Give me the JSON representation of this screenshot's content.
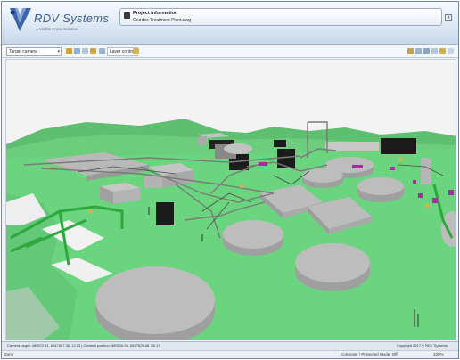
{
  "header": {
    "logo_brand": "RDV Systems",
    "logo_tagline": "A Visible Force Solution",
    "info_title": "Project information",
    "info_file": "Goodoo Treatment Plant.dwg",
    "close_label": "x"
  },
  "toolbar": {
    "camera_value": "Target camera",
    "layer_control_label": "Layer control"
  },
  "status": {
    "camera_readout": "Camera target: 489572.61, 6547657.36, 12.03 | Camera position: 489526.38, 6547625.68, 55.17",
    "copyright": "Copyright 2017 © RDV Systems"
  },
  "browser_status": {
    "zone": "Zone",
    "protected_mode": "Computer | Protected Mode: Off",
    "zoom": "100%"
  },
  "colors": {
    "terrain": "#6ad47e",
    "hills": "#52b565",
    "structure": "#b9b9b9",
    "building_dark": "#1b1b1b",
    "accent_magenta": "#a12fa0",
    "pipe_green": "#2ea83c"
  },
  "icons": [
    "rdv-logo-icon",
    "info-icon",
    "close-icon",
    "camera-dropdown-icon",
    "layer-icon",
    "nav-icon"
  ]
}
